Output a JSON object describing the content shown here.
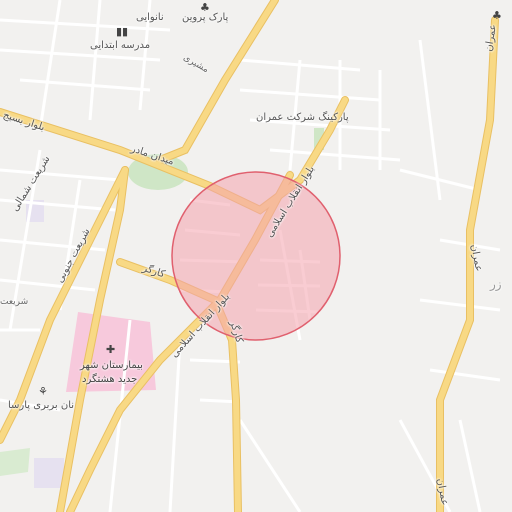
{
  "map": {
    "highlight": {
      "fill": "#f4a3ad",
      "stroke": "#e0606e"
    },
    "colors": {
      "background": "#f2f1ef",
      "major_road": "#f5d27a",
      "minor_road": "#ffffff",
      "hospital": "#f7c9dc",
      "park": "#cfe6c6"
    },
    "labels": {
      "park_parvin": "پارک پروین",
      "bakery": "نانوایی",
      "elementary_school": "مدرسه ابتدایی",
      "mashiri": "مشیری",
      "parking_omran": "پارکینگ شرکت عمران",
      "blvd_basij": "بلوار بسیج",
      "maydan_madar": "میدان مادر",
      "shariati_north": "شریعت شمالی",
      "shariati_south": "شریعت جنوبی",
      "enghelab_upper": "بلوار انقلاب اسلامی",
      "enghelab_lower": "بلوار انقلاب اسلامی",
      "kargar": "کارگر",
      "kargar_vertical": "کارگر",
      "omran_top": "عمران",
      "omran_mid": "عمران",
      "omran_bottom": "عمران",
      "zar": "زر",
      "shariat_small": "شریعت",
      "hospital_line1": "بیمارستان شهر",
      "hospital_line2": "جدید هشتگرد",
      "bakery_parsa": "نان بربری پارسا"
    },
    "icons": {
      "park": "tree-icon",
      "school": "school-icon",
      "hospital": "hospital-cross-icon",
      "bakery_parsa": "bakery-icon",
      "tree_top_right": "tree-icon"
    }
  }
}
